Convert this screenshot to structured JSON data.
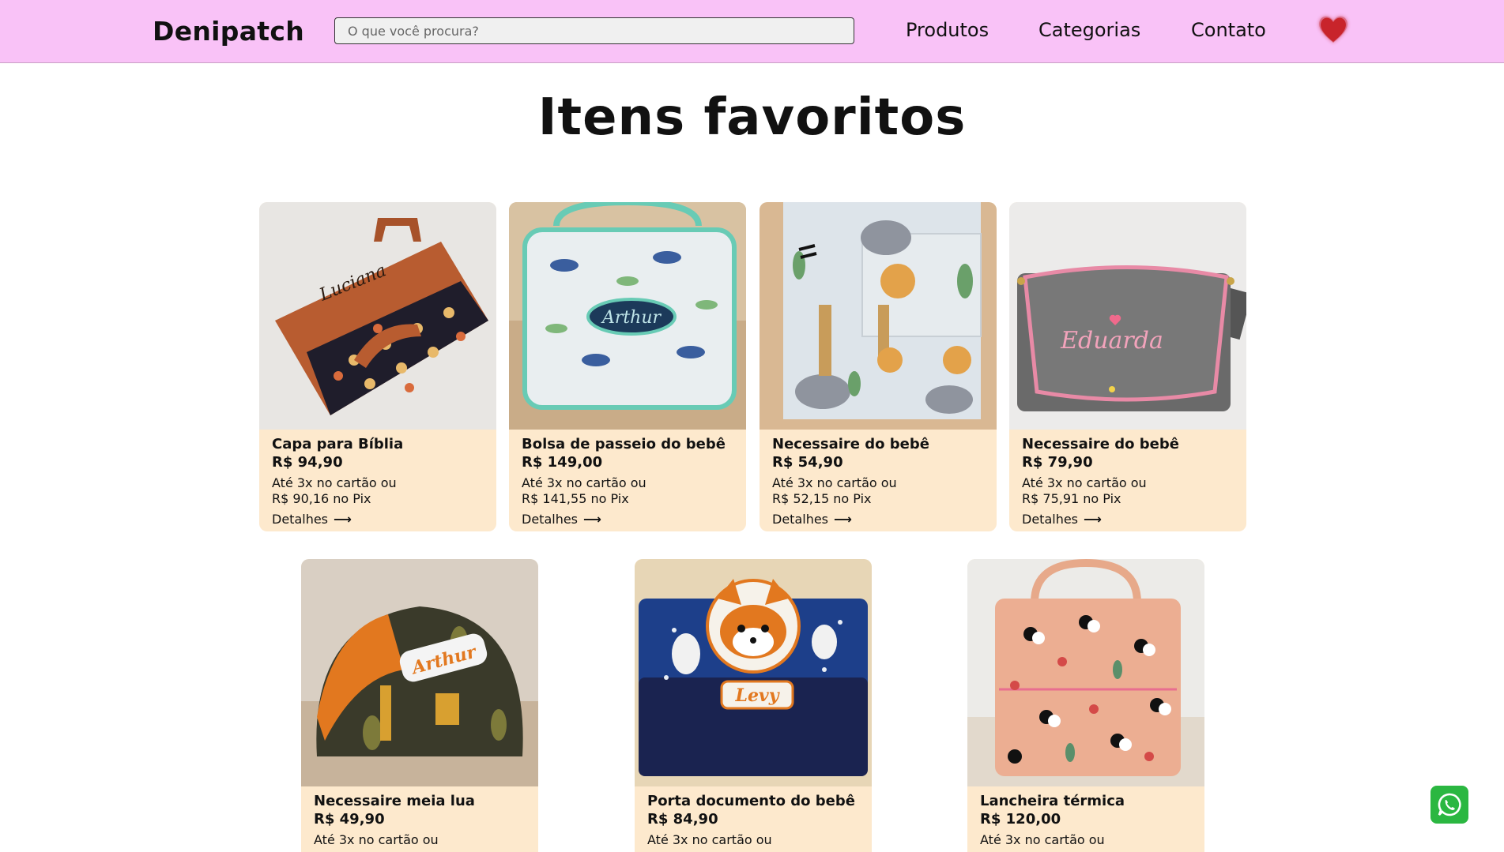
{
  "header": {
    "logo": "Denipatch",
    "search_placeholder": "O que você procura?",
    "nav": [
      "Produtos",
      "Categorias",
      "Contato"
    ],
    "favorites_icon": "heart-icon",
    "background": "#f9c2f7"
  },
  "main": {
    "title": "Itens favoritos"
  },
  "products": [
    {
      "name": "Capa para Bíblia",
      "price": "R$ 94,90",
      "installments": "Até 3x no cartão ou",
      "pix": "R$ 90,16 no Pix",
      "details": "Detalhes"
    },
    {
      "name": "Bolsa de passeio do bebê",
      "price": "R$ 149,00",
      "installments": "Até 3x no cartão ou",
      "pix": "R$ 141,55 no Pix",
      "details": "Detalhes"
    },
    {
      "name": "Necessaire do bebê",
      "price": "R$ 54,90",
      "installments": "Até 3x no cartão ou",
      "pix": "R$ 52,15 no Pix",
      "details": "Detalhes"
    },
    {
      "name": "Necessaire do bebê",
      "price": "R$ 79,90",
      "installments": "Até 3x no cartão ou",
      "pix": "R$ 75,91 no Pix",
      "details": "Detalhes"
    },
    {
      "name": "Necessaire meia lua",
      "price": "R$ 49,90",
      "installments": "Até 3x no cartão ou"
    },
    {
      "name": "Porta documento do bebê",
      "price": "R$ 84,90",
      "installments": "Até 3x no cartão ou"
    },
    {
      "name": "Lancheira térmica",
      "price": "R$ 120,00",
      "installments": "Até 3x no cartão ou"
    }
  ],
  "floating": {
    "whatsapp_icon": "whatsapp-icon",
    "color": "#2bb741"
  },
  "card_background": "#fde9cd"
}
